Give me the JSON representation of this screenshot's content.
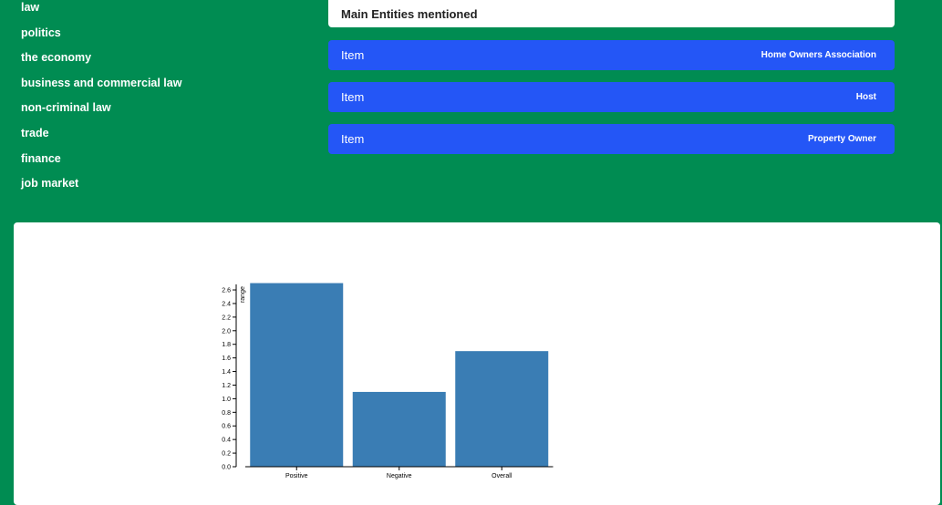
{
  "topics": [
    "law",
    "politics",
    "the economy",
    "business and commercial law",
    "non-criminal law",
    "trade",
    "finance",
    "job market"
  ],
  "entities_panel": {
    "title": "Main Entities mentioned",
    "items": [
      {
        "label": "Item",
        "value": "Home Owners Association"
      },
      {
        "label": "Item",
        "value": "Host"
      },
      {
        "label": "Item",
        "value": "Property Owner"
      }
    ]
  },
  "colors": {
    "background": "#008c52",
    "entity_item": "#2456f6",
    "bar": "#3a7db4"
  },
  "chart_data": {
    "type": "bar",
    "categories": [
      "Positive",
      "Negative",
      "Overall"
    ],
    "values": [
      2.7,
      1.1,
      1.7
    ],
    "ylabel": "range",
    "ylim": [
      0,
      2.6
    ],
    "yticks": [
      "0.0",
      "0.2",
      "0.4",
      "0.6",
      "0.8",
      "1.0",
      "1.2",
      "1.4",
      "1.6",
      "1.8",
      "2.0",
      "2.2",
      "2.4",
      "2.6"
    ],
    "grid": false
  }
}
